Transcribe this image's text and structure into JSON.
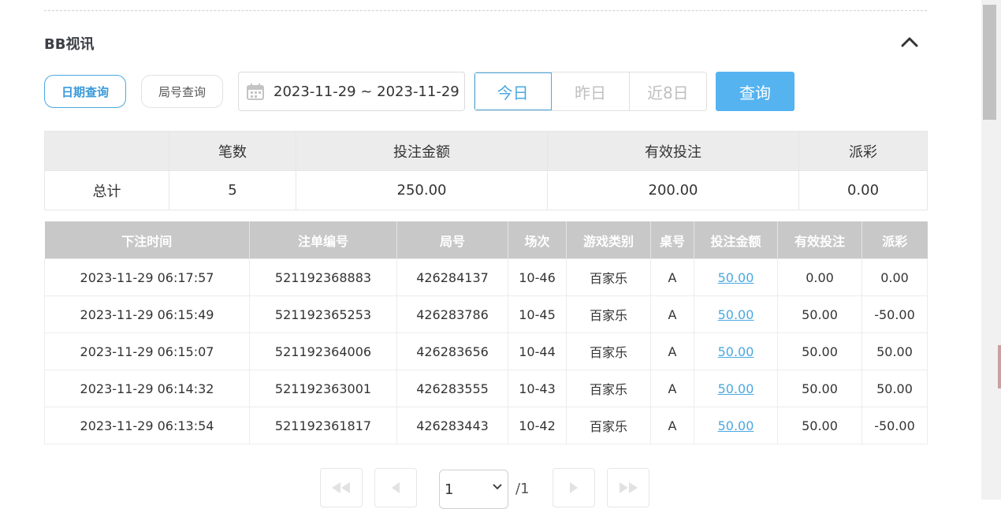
{
  "section": {
    "title": "BB视讯"
  },
  "filters": {
    "date_query_label": "日期查询",
    "round_query_label": "局号查询",
    "date_range": "2023-11-29 ~ 2023-11-29",
    "quick": [
      "今日",
      "昨日",
      "近8日"
    ],
    "query_label": "查询"
  },
  "summary": {
    "headers": [
      "",
      "笔数",
      "投注金额",
      "有效投注",
      "派彩"
    ],
    "row": {
      "label": "总计",
      "count": "5",
      "bet": "250.00",
      "valid": "200.00",
      "payout": "0.00"
    }
  },
  "bets": {
    "headers": [
      "下注时间",
      "注单编号",
      "局号",
      "场次",
      "游戏类别",
      "桌号",
      "投注金额",
      "有效投注",
      "派彩"
    ],
    "rows": [
      {
        "time": "2023-11-29 06:17:57",
        "order": "521192368883",
        "round": "426284137",
        "session": "10-46",
        "game": "百家乐",
        "table": "A",
        "bet": "50.00",
        "valid": "0.00",
        "payout": "0.00"
      },
      {
        "time": "2023-11-29 06:15:49",
        "order": "521192365253",
        "round": "426283786",
        "session": "10-45",
        "game": "百家乐",
        "table": "A",
        "bet": "50.00",
        "valid": "50.00",
        "payout": "-50.00"
      },
      {
        "time": "2023-11-29 06:15:07",
        "order": "521192364006",
        "round": "426283656",
        "session": "10-44",
        "game": "百家乐",
        "table": "A",
        "bet": "50.00",
        "valid": "50.00",
        "payout": "50.00"
      },
      {
        "time": "2023-11-29 06:14:32",
        "order": "521192363001",
        "round": "426283555",
        "session": "10-43",
        "game": "百家乐",
        "table": "A",
        "bet": "50.00",
        "valid": "50.00",
        "payout": "50.00"
      },
      {
        "time": "2023-11-29 06:13:54",
        "order": "521192361817",
        "round": "426283443",
        "session": "10-42",
        "game": "百家乐",
        "table": "A",
        "bet": "50.00",
        "valid": "50.00",
        "payout": "-50.00"
      }
    ]
  },
  "pagination": {
    "page": "1",
    "total": "/1"
  },
  "colors": {
    "accent": "#4aa8e0",
    "query_button": "#55b3f0",
    "negative": "#e0404a",
    "header_gray": "#c8c8c8"
  }
}
